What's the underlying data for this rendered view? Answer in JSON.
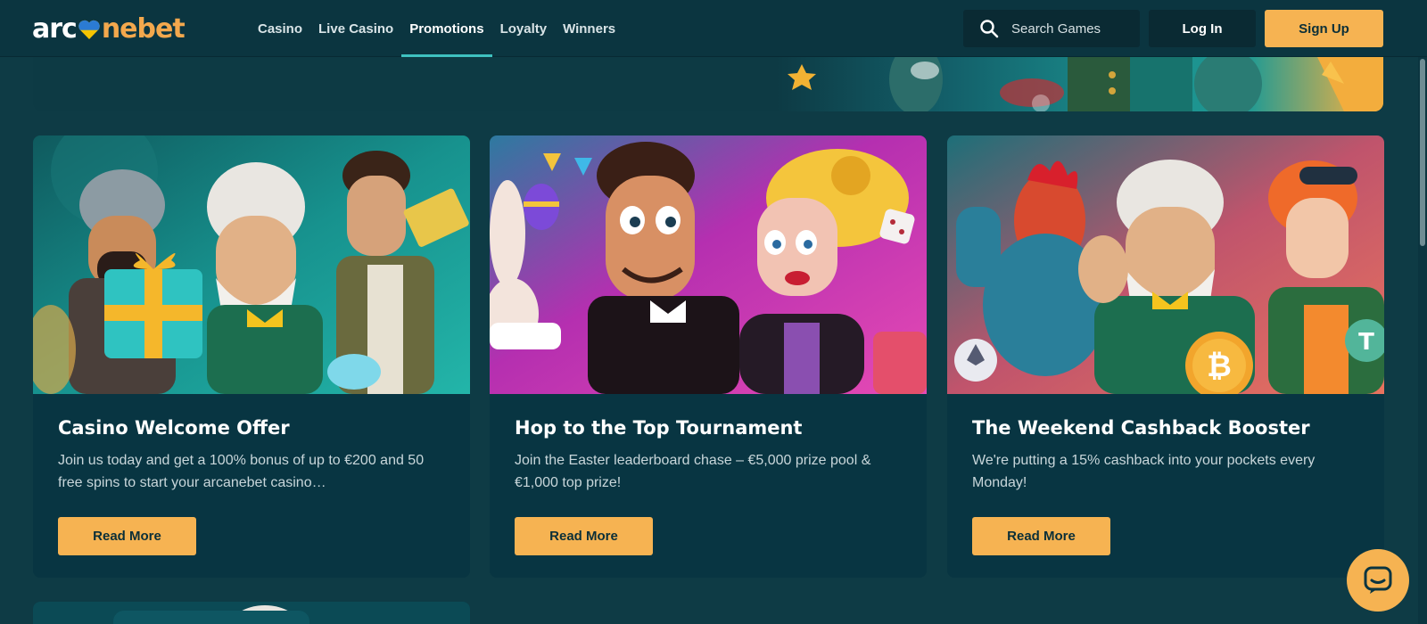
{
  "logo": {
    "text_left": "arc",
    "text_right": "nebet"
  },
  "nav": [
    {
      "label": "Casino"
    },
    {
      "label": "Live Casino"
    },
    {
      "label": "Promotions",
      "active": true
    },
    {
      "label": "Loyalty"
    },
    {
      "label": "Winners"
    }
  ],
  "search": {
    "placeholder": "Search Games"
  },
  "auth": {
    "login_label": "Log In",
    "signup_label": "Sign Up"
  },
  "promotions": [
    {
      "title": "Casino Welcome Offer",
      "description": "Join us today and get a 100% bonus of up to €200 and 50 free spins to start your arcanebet casino…",
      "button_label": "Read More"
    },
    {
      "title": "Hop to the Top Tournament",
      "description": "Join the Easter leaderboard chase – €5,000 prize pool & €1,000 top prize!",
      "button_label": "Read More"
    },
    {
      "title": "The Weekend Cashback Booster",
      "description": "We're putting a 15% cashback into your pockets every Monday!",
      "button_label": "Read More"
    }
  ],
  "colors": {
    "background": "#0e3b45",
    "header": "#0b3540",
    "card": "#083542",
    "accent_orange": "#f6b352",
    "accent_teal": "#3fc1c0"
  }
}
